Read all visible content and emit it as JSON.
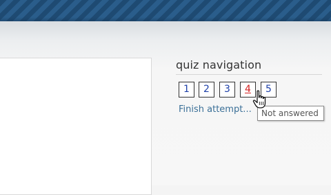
{
  "quiz_navigation": {
    "title": "quiz navigation",
    "questions": [
      {
        "label": "1",
        "status": "answered"
      },
      {
        "label": "2",
        "status": "answered"
      },
      {
        "label": "3",
        "status": "answered"
      },
      {
        "label": "4",
        "status": "not-answered"
      },
      {
        "label": "5",
        "status": "answered"
      }
    ],
    "finish_link": "Finish attempt..."
  },
  "tooltip": {
    "text": "Not answered"
  },
  "colors": {
    "header": "#1e4a72",
    "question_number": "#1d3fa8",
    "not_answered_number": "#d42020",
    "link": "#3a6f97"
  }
}
